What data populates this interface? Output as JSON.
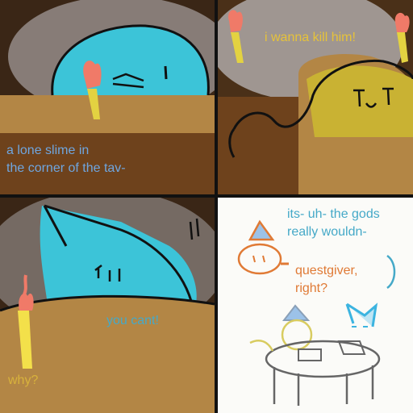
{
  "panels": [
    {
      "caption_lines": [
        "a lone slime in",
        "the corner of the tav-"
      ]
    },
    {
      "caption": "i wanna kill him!"
    },
    {
      "speech_1": "you cant!",
      "speech_2": "why?"
    },
    {
      "speech_1_lines": [
        "its- uh- the gods",
        "really wouldn-"
      ],
      "speech_2_lines": [
        "questgiver,",
        "right?"
      ]
    }
  ],
  "colors": {
    "slime_blue": "#3cc4d8",
    "slime_yellow": "#c9b233",
    "caption_blue": "#6fa6e0",
    "dialogue_blue": "#45a9c8",
    "dialogue_orange": "#e07a35",
    "why_yellow": "#d8b23c"
  }
}
